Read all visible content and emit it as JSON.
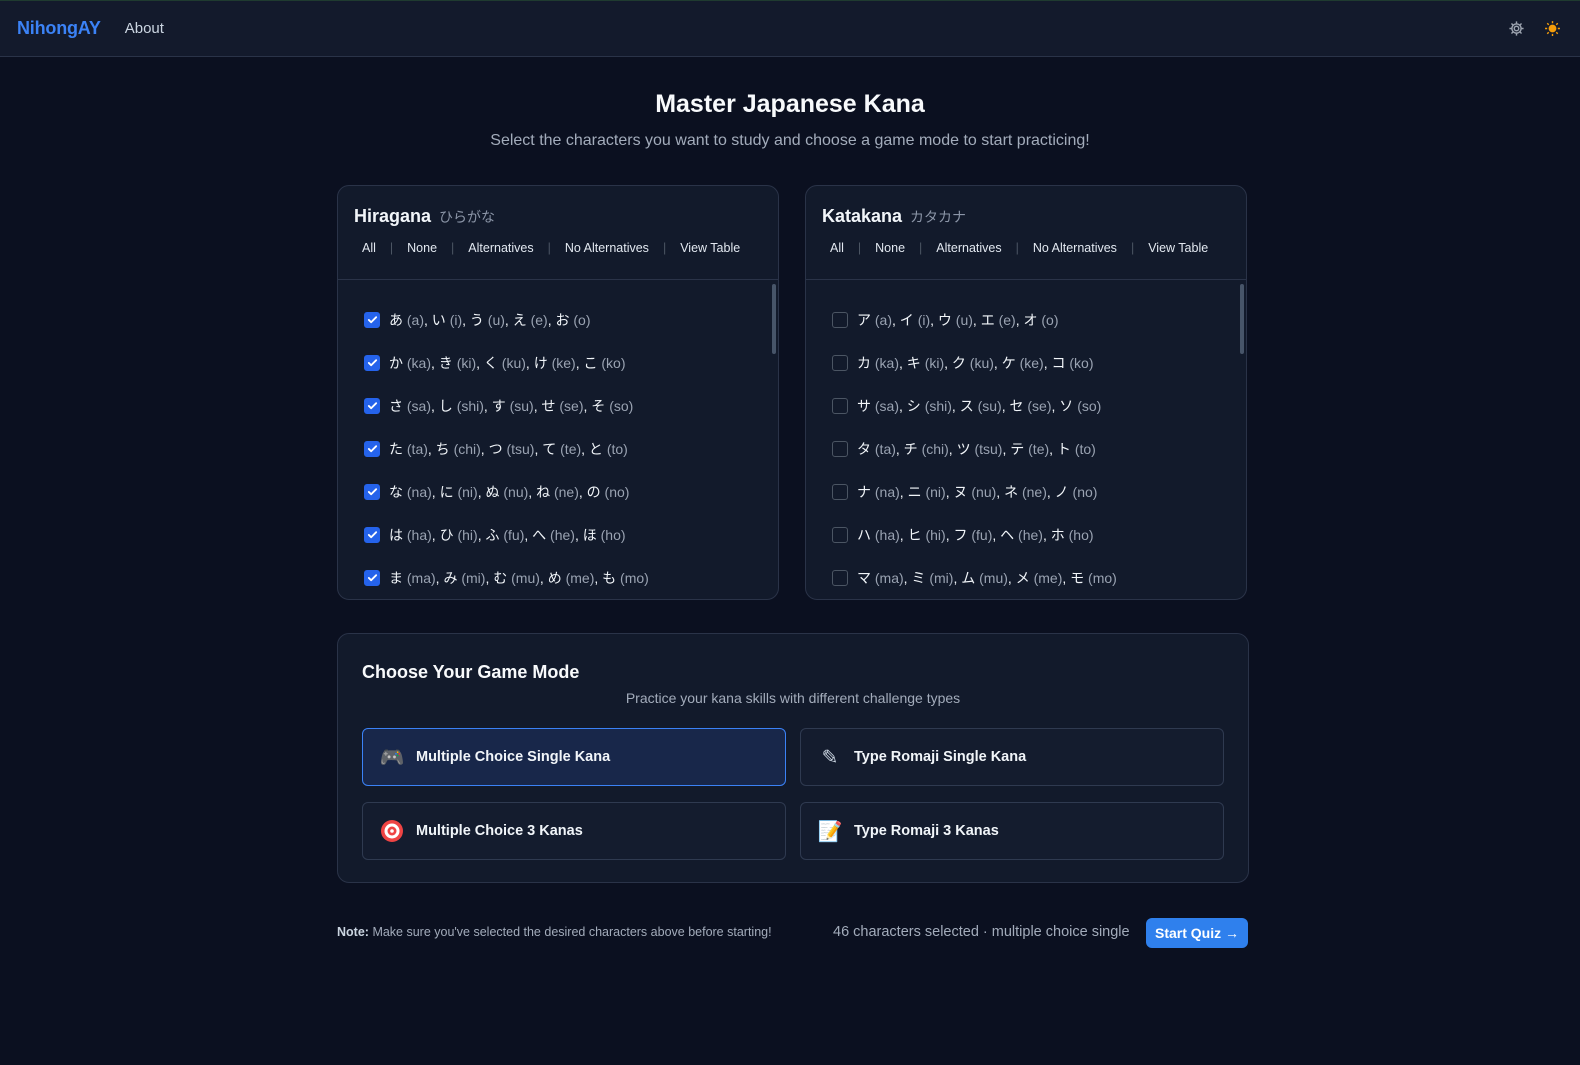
{
  "navbar": {
    "brand": "NihongAY",
    "about": "About",
    "icons": [
      "gear-icon",
      "sun-icon"
    ]
  },
  "hero": {
    "title": "Master Japanese Kana",
    "subtitle": "Select the characters you want to study and choose a game mode to start practicing!"
  },
  "hiragana": {
    "title": "Hiragana",
    "japanese": "ひらがな",
    "filters": [
      "All",
      "None",
      "Alternatives",
      "No Alternatives",
      "View Table"
    ],
    "rows": [
      {
        "checked": true,
        "kana": [
          [
            "あ",
            "(a)"
          ],
          [
            "い",
            "(i)"
          ],
          [
            "う",
            "(u)"
          ],
          [
            "え",
            "(e)"
          ],
          [
            "お",
            "(o)"
          ]
        ]
      },
      {
        "checked": true,
        "kana": [
          [
            "か",
            "(ka)"
          ],
          [
            "き",
            "(ki)"
          ],
          [
            "く",
            "(ku)"
          ],
          [
            "け",
            "(ke)"
          ],
          [
            "こ",
            "(ko)"
          ]
        ]
      },
      {
        "checked": true,
        "kana": [
          [
            "さ",
            "(sa)"
          ],
          [
            "し",
            "(shi)"
          ],
          [
            "す",
            "(su)"
          ],
          [
            "せ",
            "(se)"
          ],
          [
            "そ",
            "(so)"
          ]
        ]
      },
      {
        "checked": true,
        "kana": [
          [
            "た",
            "(ta)"
          ],
          [
            "ち",
            "(chi)"
          ],
          [
            "つ",
            "(tsu)"
          ],
          [
            "て",
            "(te)"
          ],
          [
            "と",
            "(to)"
          ]
        ]
      },
      {
        "checked": true,
        "kana": [
          [
            "な",
            "(na)"
          ],
          [
            "に",
            "(ni)"
          ],
          [
            "ぬ",
            "(nu)"
          ],
          [
            "ね",
            "(ne)"
          ],
          [
            "の",
            "(no)"
          ]
        ]
      },
      {
        "checked": true,
        "kana": [
          [
            "は",
            "(ha)"
          ],
          [
            "ひ",
            "(hi)"
          ],
          [
            "ふ",
            "(fu)"
          ],
          [
            "へ",
            "(he)"
          ],
          [
            "ほ",
            "(ho)"
          ]
        ]
      },
      {
        "checked": true,
        "kana": [
          [
            "ま",
            "(ma)"
          ],
          [
            "み",
            "(mi)"
          ],
          [
            "む",
            "(mu)"
          ],
          [
            "め",
            "(me)"
          ],
          [
            "も",
            "(mo)"
          ]
        ]
      }
    ]
  },
  "katakana": {
    "title": "Katakana",
    "japanese": "カタカナ",
    "filters": [
      "All",
      "None",
      "Alternatives",
      "No Alternatives",
      "View Table"
    ],
    "rows": [
      {
        "checked": false,
        "kana": [
          [
            "ア",
            "(a)"
          ],
          [
            "イ",
            "(i)"
          ],
          [
            "ウ",
            "(u)"
          ],
          [
            "エ",
            "(e)"
          ],
          [
            "オ",
            "(o)"
          ]
        ]
      },
      {
        "checked": false,
        "kana": [
          [
            "カ",
            "(ka)"
          ],
          [
            "キ",
            "(ki)"
          ],
          [
            "ク",
            "(ku)"
          ],
          [
            "ケ",
            "(ke)"
          ],
          [
            "コ",
            "(ko)"
          ]
        ]
      },
      {
        "checked": false,
        "kana": [
          [
            "サ",
            "(sa)"
          ],
          [
            "シ",
            "(shi)"
          ],
          [
            "ス",
            "(su)"
          ],
          [
            "セ",
            "(se)"
          ],
          [
            "ソ",
            "(so)"
          ]
        ]
      },
      {
        "checked": false,
        "kana": [
          [
            "タ",
            "(ta)"
          ],
          [
            "チ",
            "(chi)"
          ],
          [
            "ツ",
            "(tsu)"
          ],
          [
            "テ",
            "(te)"
          ],
          [
            "ト",
            "(to)"
          ]
        ]
      },
      {
        "checked": false,
        "kana": [
          [
            "ナ",
            "(na)"
          ],
          [
            "ニ",
            "(ni)"
          ],
          [
            "ヌ",
            "(nu)"
          ],
          [
            "ネ",
            "(ne)"
          ],
          [
            "ノ",
            "(no)"
          ]
        ]
      },
      {
        "checked": false,
        "kana": [
          [
            "ハ",
            "(ha)"
          ],
          [
            "ヒ",
            "(hi)"
          ],
          [
            "フ",
            "(fu)"
          ],
          [
            "ヘ",
            "(he)"
          ],
          [
            "ホ",
            "(ho)"
          ]
        ]
      },
      {
        "checked": false,
        "kana": [
          [
            "マ",
            "(ma)"
          ],
          [
            "ミ",
            "(mi)"
          ],
          [
            "ム",
            "(mu)"
          ],
          [
            "メ",
            "(me)"
          ],
          [
            "モ",
            "(mo)"
          ]
        ]
      }
    ]
  },
  "game_mode": {
    "title": "Choose Your Game Mode",
    "subtitle": "Practice your kana skills with different challenge types",
    "modes": [
      {
        "label": "Multiple Choice Single Kana",
        "icon": "gamepad-icon",
        "glyph": "🎮",
        "selected": true
      },
      {
        "label": "Type Romaji Single Kana",
        "icon": "pencil-icon",
        "glyph": "✎",
        "selected": false
      },
      {
        "label": "Multiple Choice 3 Kanas",
        "icon": "target-icon",
        "glyph": "◎",
        "selected": false
      },
      {
        "label": "Type Romaji 3 Kanas",
        "icon": "memo-icon",
        "glyph": "📝",
        "selected": false
      }
    ]
  },
  "footer": {
    "note_label": "Note:",
    "note_text": "Make sure you've selected the desired characters above before starting!",
    "status": "46 characters selected · multiple choice single",
    "start_label": "Start Quiz →"
  },
  "colors": {
    "accent": "#3b82f6",
    "background": "#0b1020",
    "card": "#121a2b",
    "border": "#2a3348"
  }
}
